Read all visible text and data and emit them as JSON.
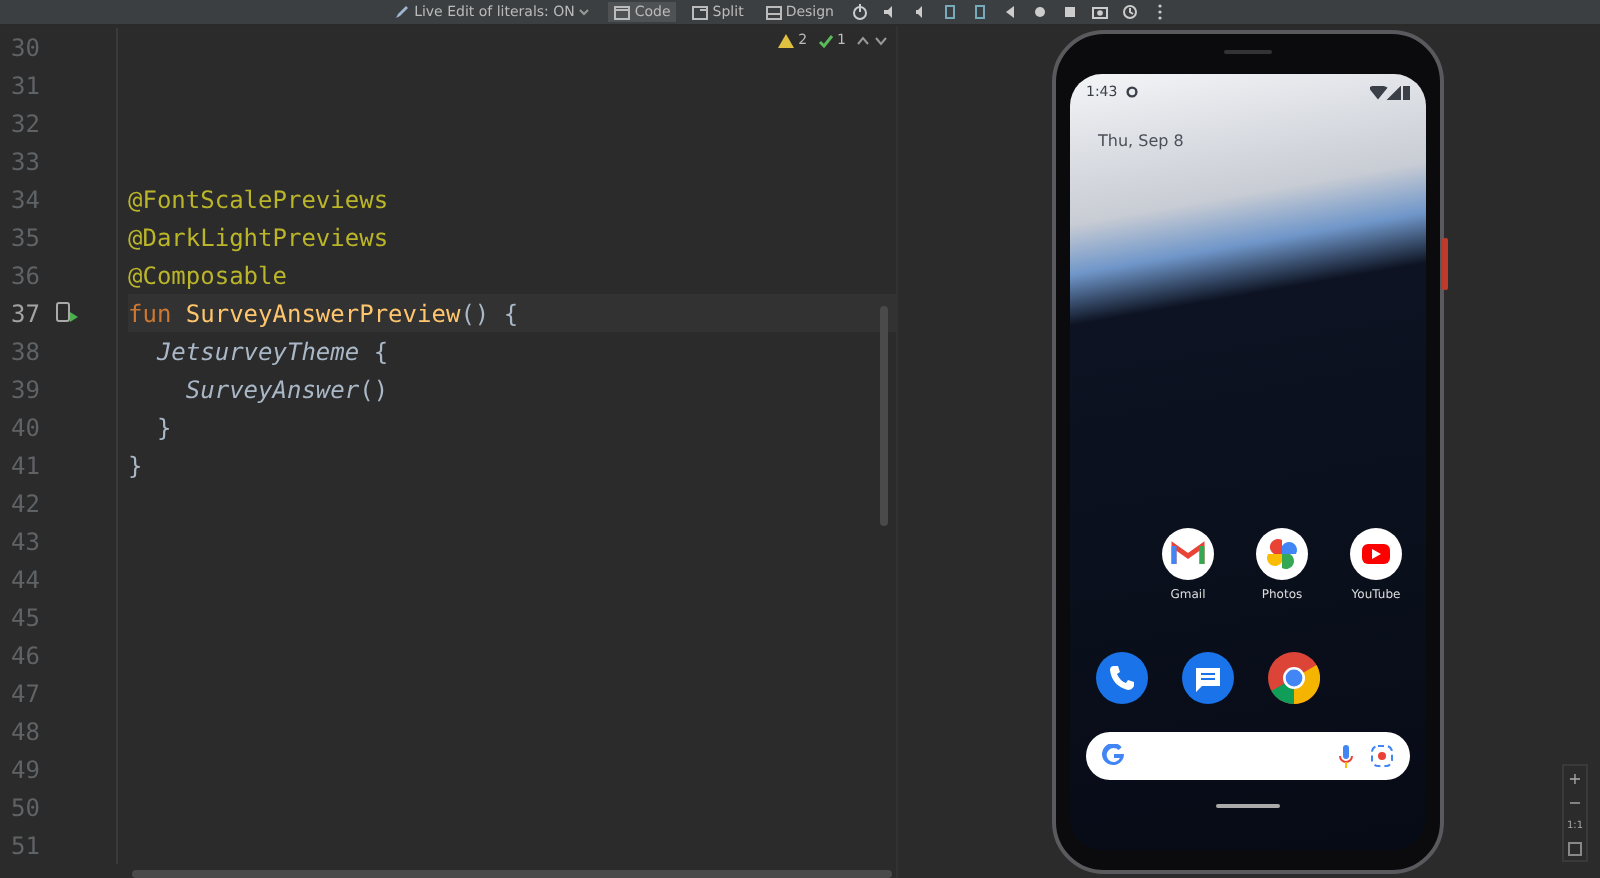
{
  "toolbar": {
    "live_edit": "Live Edit of literals: ON",
    "view_modes": [
      {
        "label": "Code",
        "selected": true
      },
      {
        "label": "Split",
        "selected": false
      },
      {
        "label": "Design",
        "selected": false
      }
    ]
  },
  "inspections": {
    "warnings": "2",
    "checks": "1"
  },
  "editor": {
    "lines": [
      {
        "number": "30",
        "current": false
      },
      {
        "number": "31",
        "current": false
      },
      {
        "number": "32",
        "current": false
      },
      {
        "number": "33",
        "current": false
      },
      {
        "number": "34",
        "current": false,
        "tokens": [
          {
            "kind": "annotation",
            "text": "@FontScalePreviews"
          }
        ]
      },
      {
        "number": "35",
        "current": false,
        "tokens": [
          {
            "kind": "annotation",
            "text": "@DarkLightPreviews"
          }
        ]
      },
      {
        "number": "36",
        "current": false,
        "tokens": [
          {
            "kind": "annotation",
            "text": "@Composable"
          }
        ]
      },
      {
        "number": "37",
        "current": true,
        "tokens": [
          {
            "kind": "keyword",
            "text": "fun "
          },
          {
            "kind": "function",
            "text": "SurveyAnswerPreview"
          },
          {
            "kind": "plain",
            "text": "() {"
          }
        ]
      },
      {
        "number": "38",
        "current": false,
        "tokens": [
          {
            "kind": "call",
            "text": "  JetsurveyTheme"
          },
          {
            "kind": "plain",
            "text": " {"
          }
        ]
      },
      {
        "number": "39",
        "current": false,
        "tokens": [
          {
            "kind": "call",
            "text": "    SurveyAnswer"
          },
          {
            "kind": "plain",
            "text": "()"
          }
        ]
      },
      {
        "number": "40",
        "current": false,
        "tokens": [
          {
            "kind": "plain",
            "text": "  }"
          }
        ]
      },
      {
        "number": "41",
        "current": false,
        "tokens": [
          {
            "kind": "plain",
            "text": "}"
          }
        ]
      },
      {
        "number": "42",
        "current": false
      },
      {
        "number": "43",
        "current": false
      },
      {
        "number": "44",
        "current": false
      },
      {
        "number": "45",
        "current": false
      },
      {
        "number": "46",
        "current": false
      },
      {
        "number": "47",
        "current": false
      },
      {
        "number": "48",
        "current": false
      },
      {
        "number": "49",
        "current": false
      },
      {
        "number": "50",
        "current": false
      },
      {
        "number": "51",
        "current": false
      }
    ]
  },
  "phone": {
    "time": "1:43",
    "date": "Thu, Sep 8",
    "apps": [
      {
        "label": "Gmail",
        "kind": "gmail"
      },
      {
        "label": "Photos",
        "kind": "photos"
      },
      {
        "label": "YouTube",
        "kind": "youtube"
      }
    ],
    "dock": [
      {
        "kind": "phone"
      },
      {
        "kind": "messages"
      },
      {
        "kind": "chrome"
      }
    ]
  },
  "zoom_controls": {
    "zoom_in": "+",
    "zoom_out": "−",
    "actual_size": "1:1"
  }
}
